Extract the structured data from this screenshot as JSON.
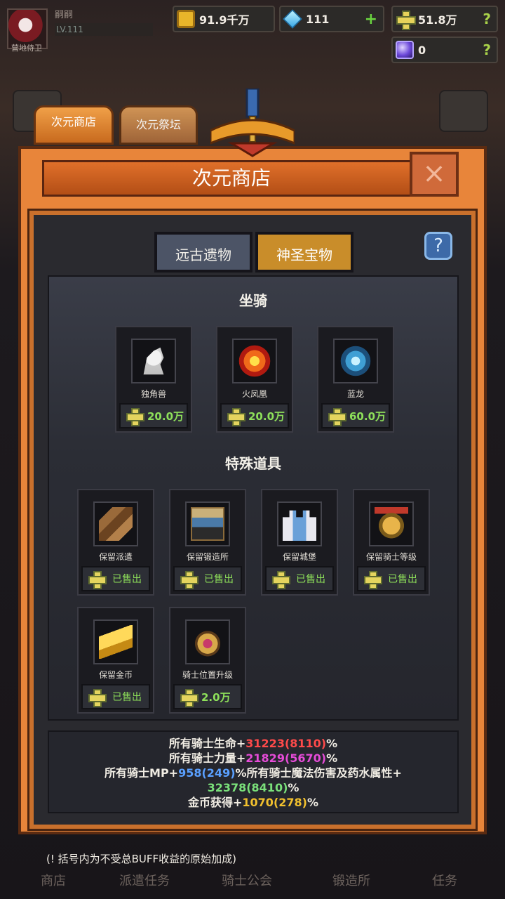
{
  "hud": {
    "player_name": "嗣嗣",
    "level": "LV.111",
    "caption": "营地侍卫",
    "gold": "91.9千万",
    "gems": "111",
    "gems_plus": "+",
    "crosses": "51.8万",
    "orbs": "0",
    "help": "?"
  },
  "top_tabs": [
    {
      "label": "次元商店"
    },
    {
      "label": "次元祭坛"
    }
  ],
  "window": {
    "title": "次元商店",
    "close": "×"
  },
  "sub_tabs": [
    {
      "label": "远古遗物"
    },
    {
      "label": "神圣宝物"
    }
  ],
  "help_button": "?",
  "sections": {
    "mounts_title": "坐骑",
    "special_title": "特殊道具"
  },
  "mounts": [
    {
      "name": "独角兽",
      "price": "20.0万"
    },
    {
      "name": "火凤凰",
      "price": "20.0万"
    },
    {
      "name": "蓝龙",
      "price": "60.0万"
    }
  ],
  "special_items": [
    {
      "name": "保留派遣",
      "price": "已售出"
    },
    {
      "name": "保留锻造所",
      "price": "已售出"
    },
    {
      "name": "保留城堡",
      "price": "已售出"
    },
    {
      "name": "保留骑士等级",
      "price": "已售出"
    },
    {
      "name": "保留金币",
      "price": "已售出"
    },
    {
      "name": "骑士位置升级",
      "price": "2.0万"
    }
  ],
  "stats": {
    "hp_label": "所有骑士生命+",
    "hp_value": "31223(8110)",
    "hp_unit": "%",
    "str_label": "所有骑士力量+",
    "str_value": "21829(5670)",
    "str_unit": "%",
    "mp_label": "所有骑士MP+",
    "mp_value": "958(249)",
    "magic_label": "%所有骑士魔法伤害及药水属性+",
    "magic_value": "32378(8410)",
    "magic_unit": "%",
    "gold_label": "金币获得+",
    "gold_value": "1070(278)",
    "gold_unit": "%"
  },
  "note": "(! 括号内为不受总BUFF收益的原始加成)",
  "bottom_nav": [
    "商店",
    "派遣任务",
    "骑士公会",
    "锻造所",
    "任务"
  ]
}
